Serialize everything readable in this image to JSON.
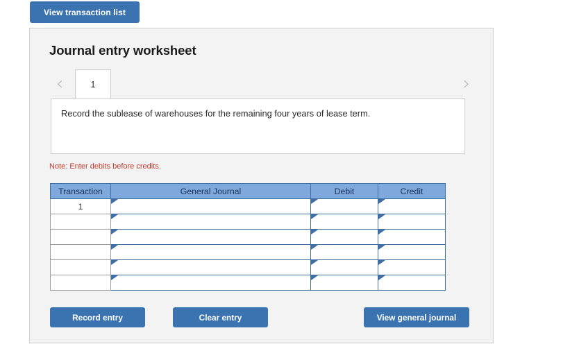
{
  "top_bar": {
    "view_transaction_list_label": "View transaction list"
  },
  "panel": {
    "title": "Journal entry worksheet",
    "pager": {
      "prev_icon": "chevron-left-icon",
      "next_icon": "chevron-right-icon",
      "tabs": [
        {
          "label": "1",
          "active": true
        }
      ]
    },
    "prompt": {
      "text": "Record the sublease of warehouses for the remaining four years of lease term."
    },
    "note": "Note: Enter debits before credits.",
    "table": {
      "headers": [
        "Transaction",
        "General Journal",
        "Debit",
        "Credit"
      ],
      "rows": [
        {
          "transaction": "1",
          "general_journal": "",
          "debit": "",
          "credit": ""
        },
        {
          "transaction": "",
          "general_journal": "",
          "debit": "",
          "credit": ""
        },
        {
          "transaction": "",
          "general_journal": "",
          "debit": "",
          "credit": ""
        },
        {
          "transaction": "",
          "general_journal": "",
          "debit": "",
          "credit": ""
        },
        {
          "transaction": "",
          "general_journal": "",
          "debit": "",
          "credit": ""
        },
        {
          "transaction": "",
          "general_journal": "",
          "debit": "",
          "credit": ""
        }
      ]
    },
    "actions": {
      "record_entry_label": "Record entry",
      "clear_entry_label": "Clear entry",
      "view_general_journal_label": "View general journal"
    }
  },
  "colors": {
    "button_blue": "#3b73b0",
    "table_header_blue": "#7fa9dc",
    "table_input_border": "#3f6fa5",
    "note_red": "#c0392b",
    "panel_bg": "#f3f3f3"
  }
}
